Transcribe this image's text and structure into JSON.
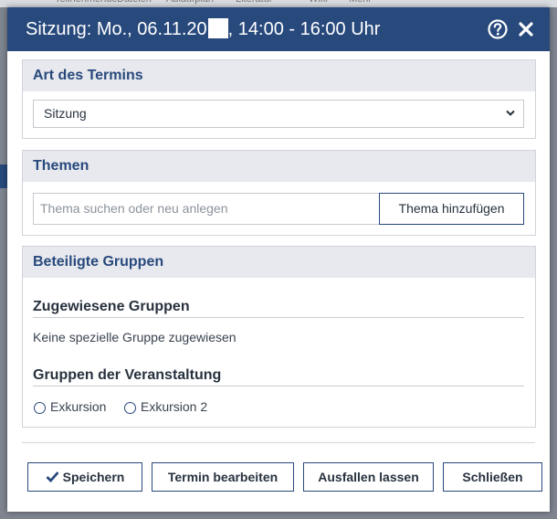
{
  "background": {
    "nav_items": [
      "Teilnehmende",
      "Dateien",
      "Ablaufplan",
      "Literatur",
      "Wiki",
      "Mehr"
    ]
  },
  "dialog": {
    "title_prefix": "Sitzung: Mo., 06.11.20",
    "title_suffix": ", 14:00 - 16:00 Uhr",
    "help_icon": "question-circle-icon",
    "close_icon": "close-icon"
  },
  "art": {
    "heading": "Art des Termins",
    "selected": "Sitzung",
    "chevron_icon": "chevron-down-icon"
  },
  "themen": {
    "heading": "Themen",
    "search_placeholder": "Thema suchen oder neu anlegen",
    "add_label": "Thema hinzufügen"
  },
  "gruppen": {
    "heading": "Beteiligte Gruppen",
    "assigned_heading": "Zugewiesene Gruppen",
    "assigned_empty": "Keine spezielle Gruppe zugewiesen",
    "course_heading": "Gruppen der Veranstaltung",
    "options": [
      "Exkursion",
      "Exkursion 2"
    ]
  },
  "footer": {
    "save": "Speichern",
    "edit": "Termin bearbeiten",
    "cancel_event": "Ausfallen lassen",
    "close": "Schließen"
  },
  "colors": {
    "primary": "#28497c",
    "panel_header": "#e7e9ee",
    "border": "#d0d4da"
  }
}
